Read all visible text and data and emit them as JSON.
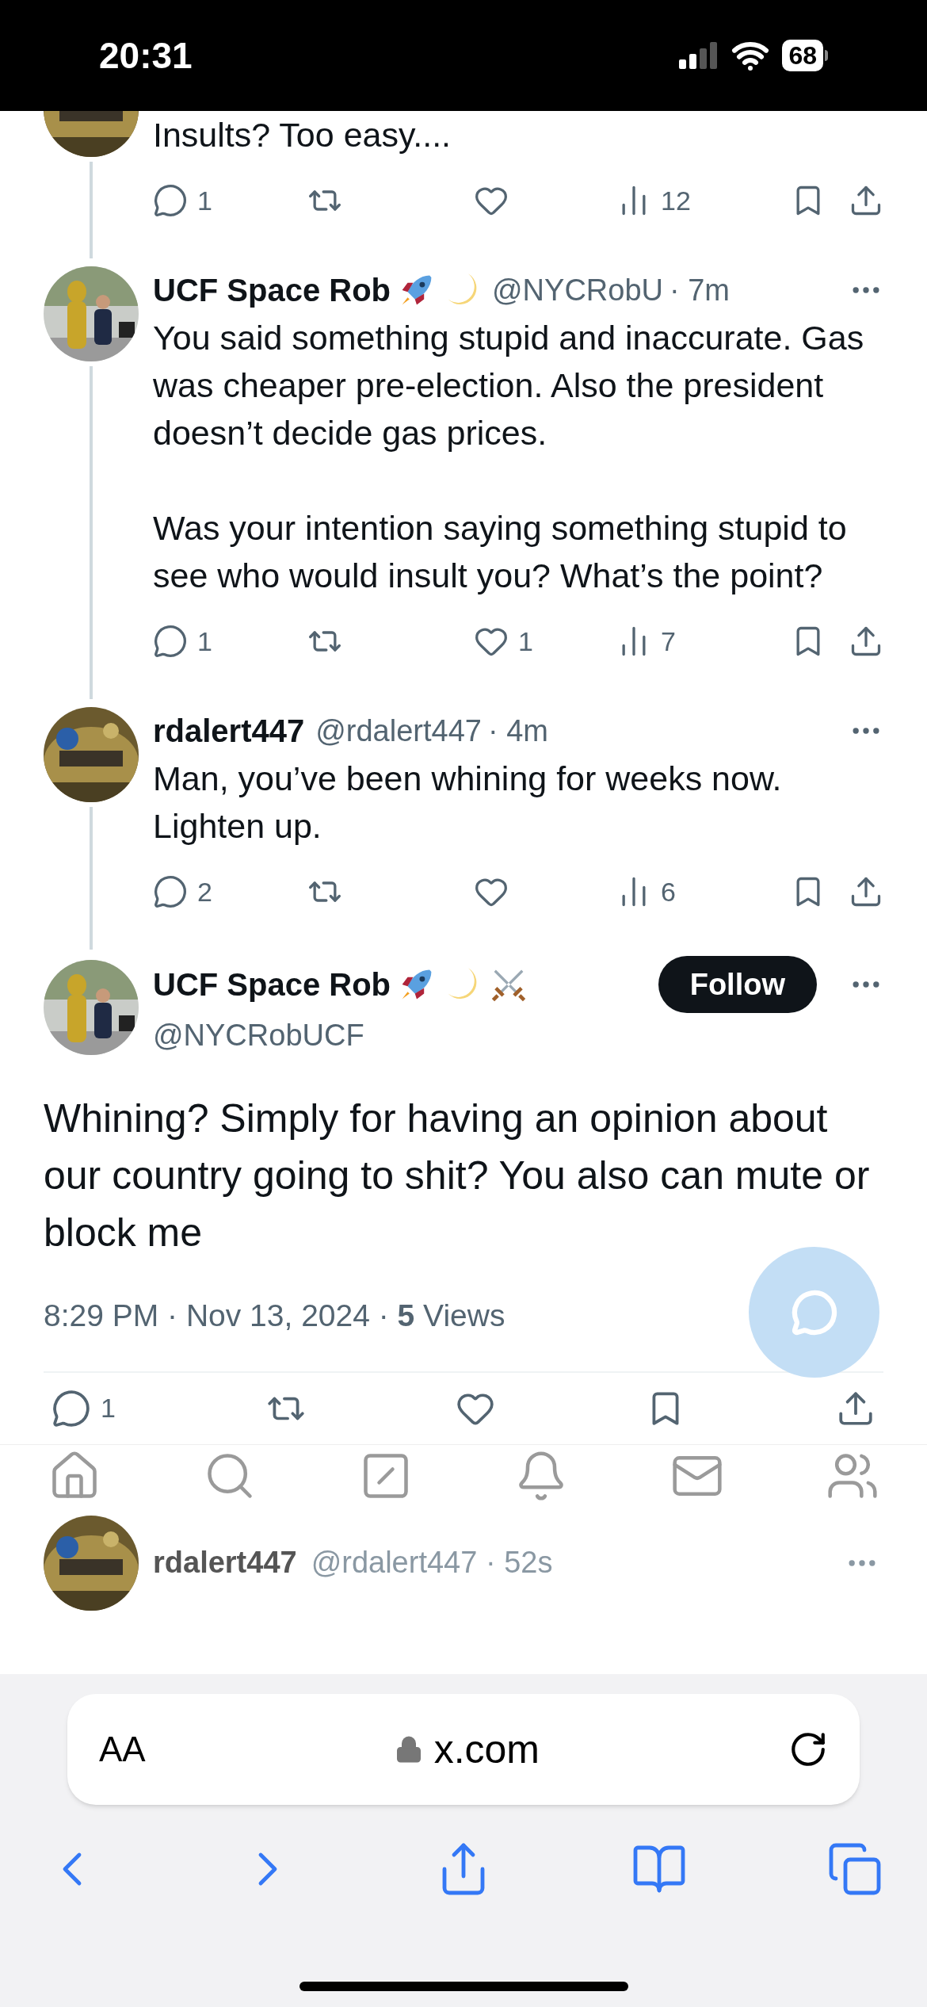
{
  "status_bar": {
    "time": "20:31",
    "battery": "68"
  },
  "replies": [
    {
      "cut_top": true,
      "text": [
        "Insults? Too easy...."
      ],
      "stats": {
        "replies": "1",
        "views": "12"
      }
    },
    {
      "cut_top": false,
      "author": "UCF Space Rob",
      "badges": [
        {
          "kind": "rocket"
        },
        {
          "kind": "moon"
        }
      ],
      "handle": "@NYCRobU",
      "time": "· 7m",
      "text": [
        "You said something stupid and inaccurate. Gas was cheaper pre-election. Also the president doesn’t decide gas prices.",
        "Was your intention saying something stupid to see who would insult you? What’s the point?"
      ],
      "stats": {
        "replies": "1",
        "likes": "1",
        "views": "7"
      }
    },
    {
      "cut_top": false,
      "author": "rdalert447",
      "handle": "@rdalert447",
      "time": "· 4m",
      "text": [
        "Man, you’ve been whining for weeks now. Lighten up."
      ],
      "stats": {
        "replies": "2",
        "views": "6"
      }
    }
  ],
  "main_tweet": {
    "author": "UCF Space Rob",
    "badges": [
      {
        "kind": "rocket"
      },
      {
        "kind": "moon"
      },
      {
        "kind": "swords"
      }
    ],
    "handle": "@NYCRobUCF",
    "follow_label": "Follow",
    "text": "Whining? Simply for having an opinion about our country going to shit? You also can mute or block me",
    "meta": "8:29 PM · Nov 13, 2024 · **5** Views",
    "stats": {
      "replies": "1"
    }
  },
  "next_reply": {
    "author": "rdalert447",
    "handle": "@rdalert447 · 52s"
  },
  "browser": {
    "text_size_label": "AA",
    "url": "x.com"
  }
}
